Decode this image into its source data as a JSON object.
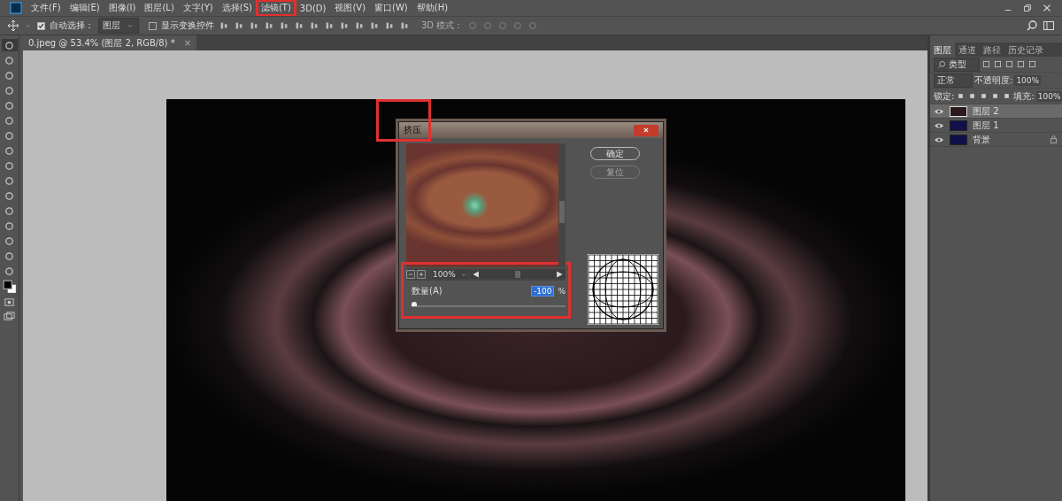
{
  "menu_bar": {
    "items": [
      {
        "label": "文件(F)",
        "selected": false
      },
      {
        "label": "编辑(E)",
        "selected": false
      },
      {
        "label": "图像(I)",
        "selected": false
      },
      {
        "label": "图层(L)",
        "selected": false
      },
      {
        "label": "文字(Y)",
        "selected": false
      },
      {
        "label": "选择(S)",
        "selected": false
      },
      {
        "label": "滤镜(T)",
        "selected": true
      },
      {
        "label": "3D(D)",
        "selected": false
      },
      {
        "label": "视图(V)",
        "selected": false
      },
      {
        "label": "窗口(W)",
        "selected": false
      },
      {
        "label": "帮助(H)",
        "selected": false
      }
    ]
  },
  "options_bar": {
    "auto_select": {
      "label": "自动选择：",
      "checked": true
    },
    "auto_select_target": "图层",
    "transform_controls": {
      "label": "显示变换控件",
      "checked": false
    },
    "mode_3d": "3D 模式："
  },
  "document_tab": {
    "title": "0.jpeg @ 53.4% (图层 2, RGB/8) *",
    "close": "×"
  },
  "layers_panel": {
    "tabs": [
      {
        "label": "图层",
        "selected": true
      },
      {
        "label": "通道",
        "selected": false
      },
      {
        "label": "路径",
        "selected": false
      },
      {
        "label": "历史记录",
        "selected": false
      }
    ],
    "filter": "类型",
    "blend_mode": "正常",
    "opacity_label": "不透明度:",
    "opacity": "100%",
    "lock_label": "锁定:",
    "fill_label": "填充:",
    "fill": "100%",
    "layers": [
      {
        "name": "图层 2",
        "selected": true,
        "locked": false
      },
      {
        "name": "图层 1",
        "selected": false,
        "locked": false
      },
      {
        "name": "背景",
        "selected": false,
        "locked": true
      }
    ]
  },
  "dialog": {
    "title": "挤压",
    "buttons": [
      "确定",
      "复位"
    ],
    "zoom": "100%",
    "amount_label": "数量(A)",
    "amount": "-100",
    "unit": "%",
    "amount_slider": {
      "level": 0.0
    }
  }
}
